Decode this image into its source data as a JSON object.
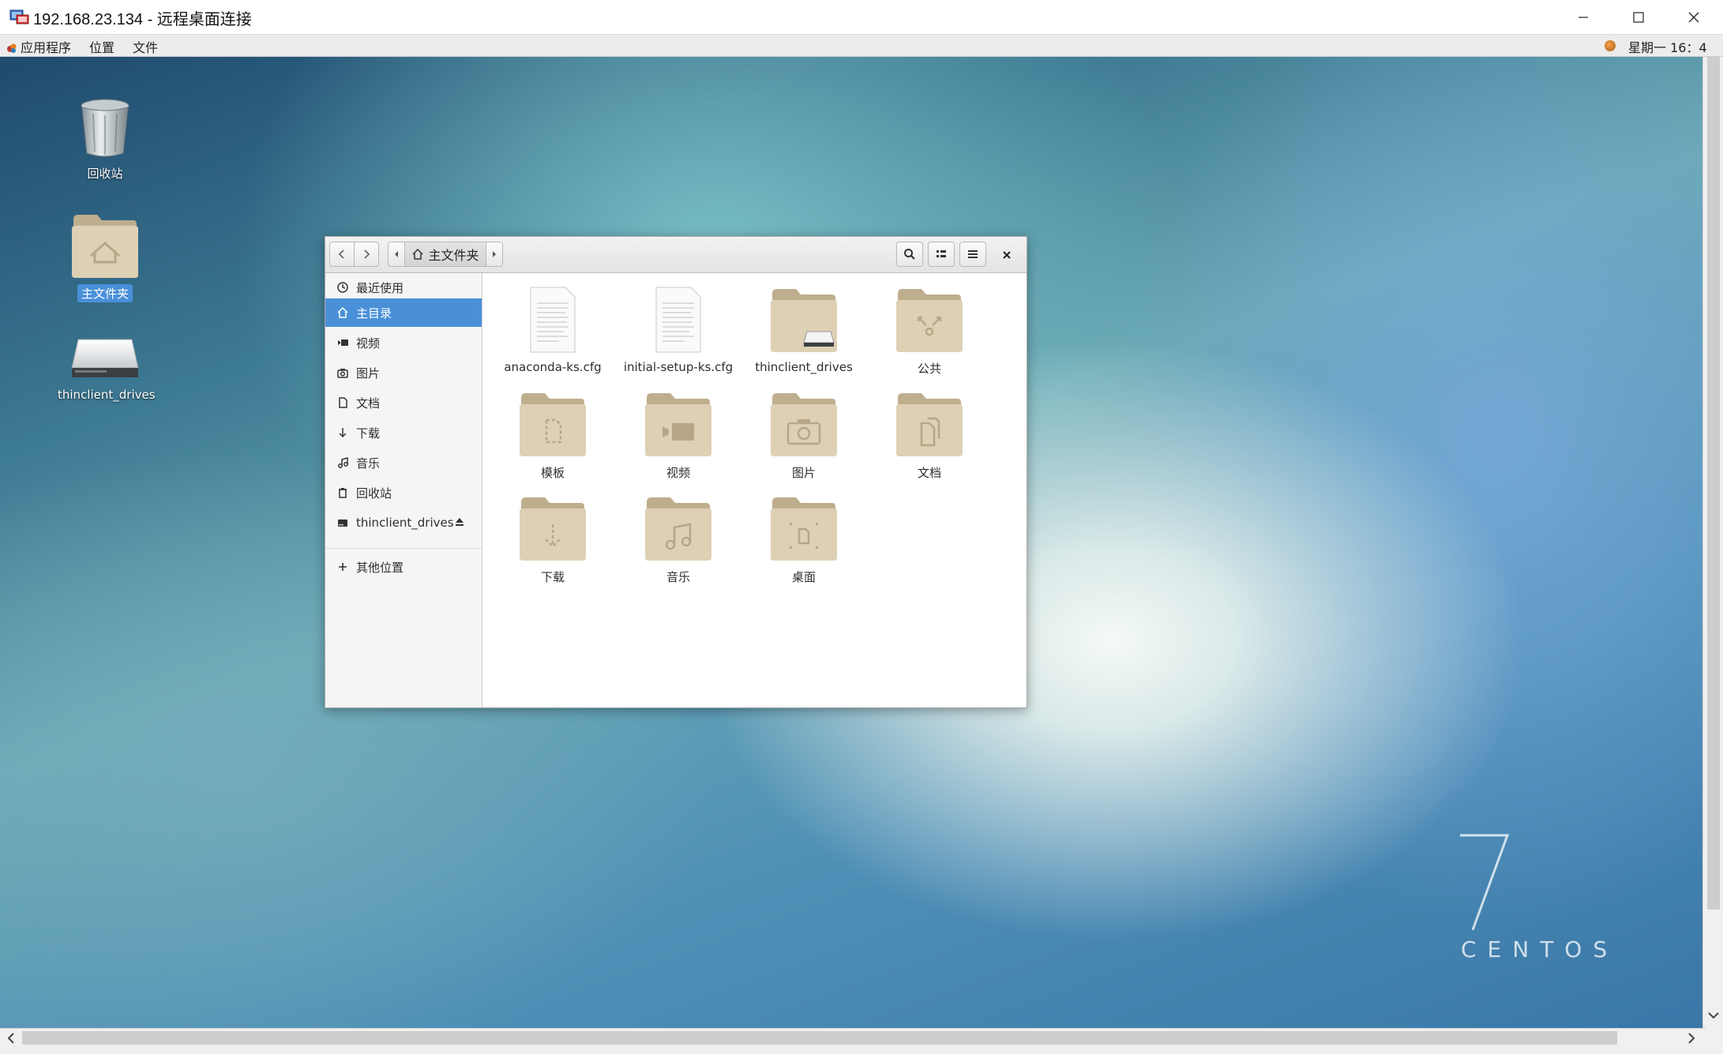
{
  "rdp": {
    "title": "192.168.23.134 - 远程桌面连接"
  },
  "panel": {
    "apps": "应用程序",
    "places": "位置",
    "file": "文件",
    "clock": "星期一 16：4"
  },
  "desktop": {
    "icons": [
      {
        "label": "回收站",
        "icon": "trash-icon"
      },
      {
        "label": "主文件夹",
        "icon": "home-folder-icon",
        "selected": true
      },
      {
        "label": "thinclient_drives",
        "icon": "drive-icon"
      }
    ],
    "branding": {
      "number": "7",
      "text": "CENTOS"
    }
  },
  "nautilus": {
    "path": "主文件夹",
    "sidebar": [
      {
        "label": "最近使用",
        "icon": "clock-icon"
      },
      {
        "label": "主目录",
        "icon": "home-icon",
        "active": true
      },
      {
        "label": "视频",
        "icon": "video-icon"
      },
      {
        "label": "图片",
        "icon": "camera-icon"
      },
      {
        "label": "文档",
        "icon": "document-icon"
      },
      {
        "label": "下载",
        "icon": "download-icon"
      },
      {
        "label": "音乐",
        "icon": "music-icon"
      },
      {
        "label": "回收站",
        "icon": "trash-icon"
      },
      {
        "label": "thinclient_drives",
        "icon": "drive-icon"
      },
      {
        "label": "其他位置",
        "icon": "plus-icon"
      }
    ],
    "files": [
      {
        "label": "anaconda-ks.cfg",
        "type": "text-file"
      },
      {
        "label": "initial-setup-ks.cfg",
        "type": "text-file"
      },
      {
        "label": "thinclient_drives",
        "type": "drive-folder"
      },
      {
        "label": "公共",
        "type": "share-folder"
      },
      {
        "label": "模板",
        "type": "template-folder"
      },
      {
        "label": "视频",
        "type": "video-folder"
      },
      {
        "label": "图片",
        "type": "pictures-folder"
      },
      {
        "label": "文档",
        "type": "documents-folder"
      },
      {
        "label": "下载",
        "type": "download-folder"
      },
      {
        "label": "音乐",
        "type": "music-folder"
      },
      {
        "label": "桌面",
        "type": "desktop-folder"
      }
    ]
  },
  "colors": {
    "selection": "#4a90d9",
    "folder": "#d9cbb0",
    "folder_tab": "#bfae8e"
  }
}
